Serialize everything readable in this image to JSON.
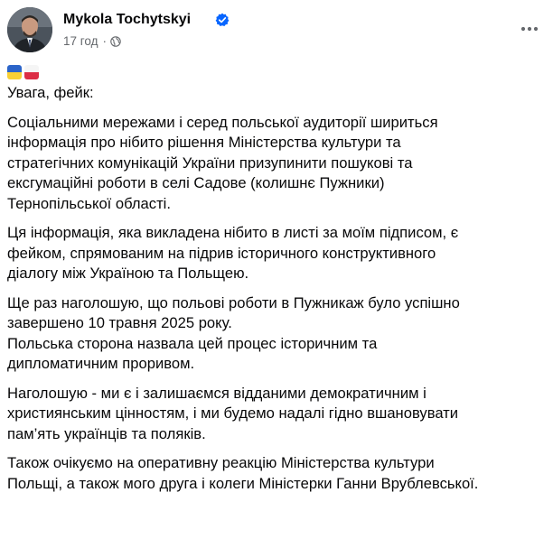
{
  "post": {
    "author_name": "Mykola Tochytskyi",
    "timestamp": "17 год",
    "separator": "·",
    "icons": {
      "verified": "verified-badge-icon",
      "audience": "globe-icon",
      "more": "more-horizontal-icon",
      "flag_1": "ukraine-flag",
      "flag_2": "poland-flag"
    },
    "colors": {
      "verified": "#0866ff",
      "ukraine_blue": "#2b64c9",
      "ukraine_yellow": "#f8d034",
      "poland_white": "#f5f5f5",
      "poland_red": "#dc2d45"
    },
    "body": {
      "intro": "Увага, фейк:",
      "paragraphs": [
        {
          "lines": [
            "Соціальними мережами і серед польської аудиторії шириться",
            "інформація про нібито рішення Міністерства культури та",
            "стратегічних комунікацій України призупинити пошукові та",
            "ексгумаційні роботи в селі Садове (колишнє Пужники)",
            "Тернопільської області."
          ]
        },
        {
          "lines": [
            "Ця інформація, яка викладена нібито в листі за моїм підписом, є",
            "фейком, спрямованим  на підрив історичного конструктивного",
            "діалогу між Україною та Польщею."
          ]
        },
        {
          "lines": [
            "Ще раз наголошую, що польові роботи в Пужникаж було успішно",
            "завершено 10 травня 2025 року.",
            "Польська сторона назвала цей процес історичним та",
            "дипломатичним проривом."
          ]
        },
        {
          "lines": [
            "Наголошую - ми є і залишаємся відданими демократичним і",
            "християнським цінностям, і ми будемо надалі гідно вшановувати",
            "пам’ять українців та поляків."
          ]
        },
        {
          "lines": [
            "Також очікуємо на оперативну реакцію Міністерства культури",
            "Польщі, а також мого друга і колеги Міністерки Ганни Врублевської."
          ]
        }
      ]
    }
  }
}
